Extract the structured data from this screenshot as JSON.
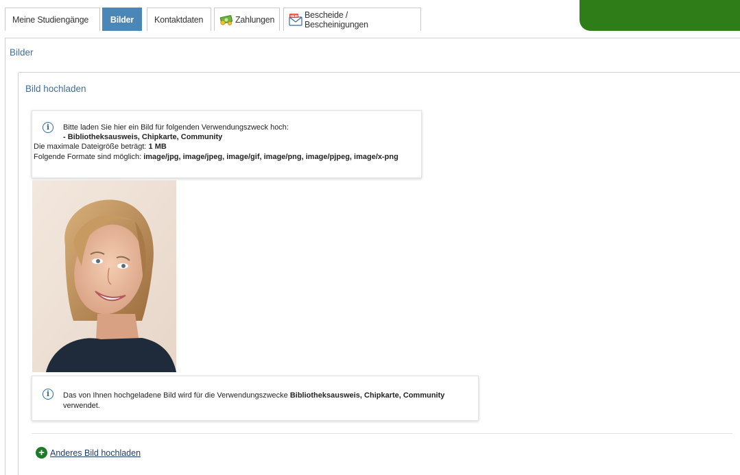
{
  "tabs": [
    {
      "label": "Meine Studiengänge",
      "active": false
    },
    {
      "label": "Bilder",
      "active": true
    },
    {
      "label": "Kontaktdaten",
      "active": false
    },
    {
      "label": "Zahlungen",
      "active": false,
      "icon": "money-icon"
    },
    {
      "label": "Bescheide / Bescheinigungen",
      "active": false,
      "icon": "new-mail-icon"
    }
  ],
  "colors": {
    "active_tab": "#4a86b8",
    "header_bar": "#2f7d18",
    "title": "#3d6e9c",
    "info_icon": "#2f6aa6",
    "add_icon": "#1d7a27"
  },
  "panel": {
    "title": "Bilder",
    "upload_section_title": "Bild hochladen"
  },
  "info_upload": {
    "line1": "Bitte laden Sie hier ein Bild für folgenden Verwendungszweck hoch:",
    "purpose": "- Bibliotheksausweis, Chipkarte, Community",
    "max_size_label": "Die maximale Dateigröße beträgt: ",
    "max_size_value": "1 MB",
    "formats_label": "Folgende Formate sind möglich: ",
    "formats_value": "image/jpg, image/jpeg, image/gif, image/png, image/pjpeg, image/x-png"
  },
  "info_used": {
    "text_before": "Das von Ihnen hochgeladene Bild wird für die Verwendungszwecke ",
    "purposes": "Bibliotheksausweis, Chipkarte, Community",
    "text_after": "verwendet."
  },
  "actions": {
    "upload_other": "Anderes Bild hochladen"
  }
}
